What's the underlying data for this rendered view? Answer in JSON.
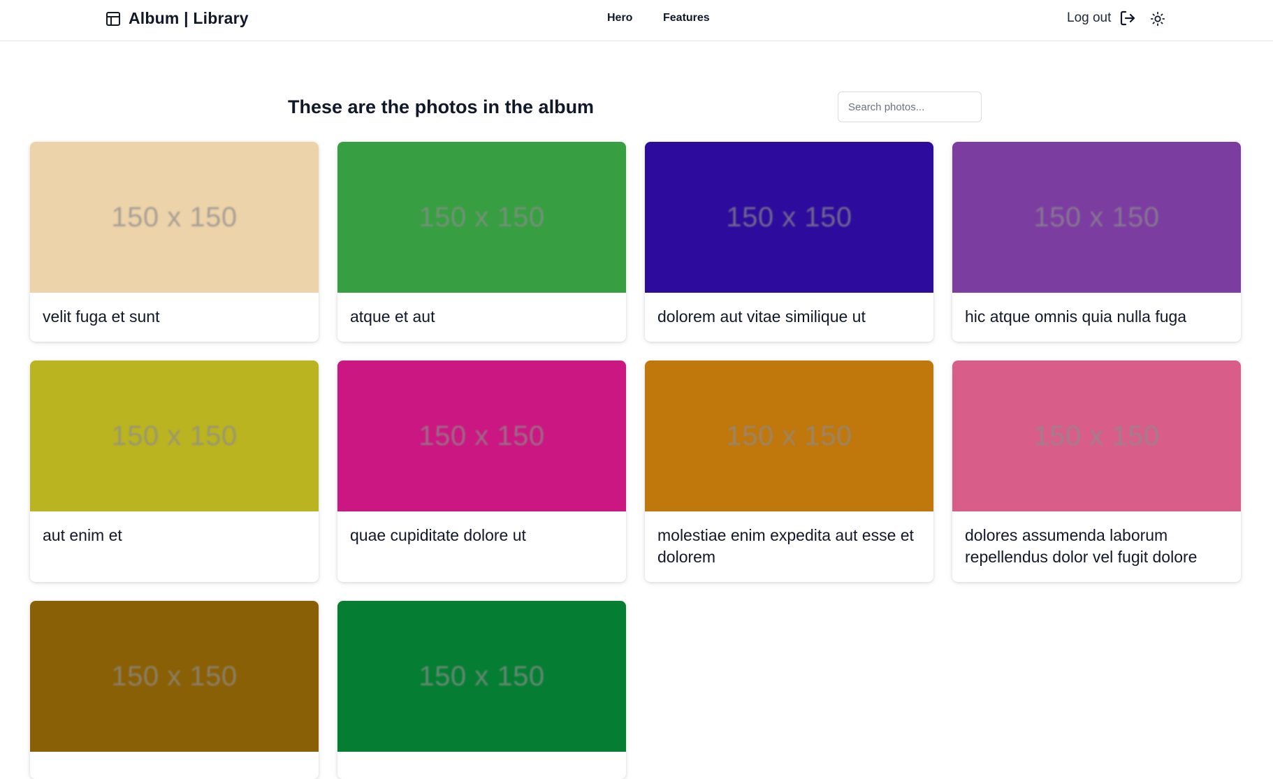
{
  "navbar": {
    "brand": "Album | Library",
    "links": [
      "Hero",
      "Features"
    ],
    "logout_label": "Log out"
  },
  "main": {
    "heading": "These are the photos in the album",
    "search_placeholder": "Search photos..."
  },
  "photos": [
    {
      "title": "velit fuga et sunt",
      "placeholder": "150 x 150",
      "color": "#edd3aa"
    },
    {
      "title": "atque et aut",
      "placeholder": "150 x 150",
      "color": "#379f42"
    },
    {
      "title": "dolorem aut vitae similique ut",
      "placeholder": "150 x 150",
      "color": "#2d0b9d"
    },
    {
      "title": "hic atque omnis quia nulla fuga",
      "placeholder": "150 x 150",
      "color": "#7c3da1"
    },
    {
      "title": "aut enim et",
      "placeholder": "150 x 150",
      "color": "#bbb421"
    },
    {
      "title": "quae cupiditate dolore ut",
      "placeholder": "150 x 150",
      "color": "#cb1781"
    },
    {
      "title": "molestiae enim expedita aut esse et dolorem",
      "placeholder": "150 x 150",
      "color": "#c0770c"
    },
    {
      "title": "dolores assumenda laborum repellendus dolor vel fugit dolore",
      "placeholder": "150 x 150",
      "color": "#d95d89"
    },
    {
      "title": "",
      "placeholder": "150 x 150",
      "color": "#8a6006"
    },
    {
      "title": "",
      "placeholder": "150 x 150",
      "color": "#057e33"
    }
  ]
}
